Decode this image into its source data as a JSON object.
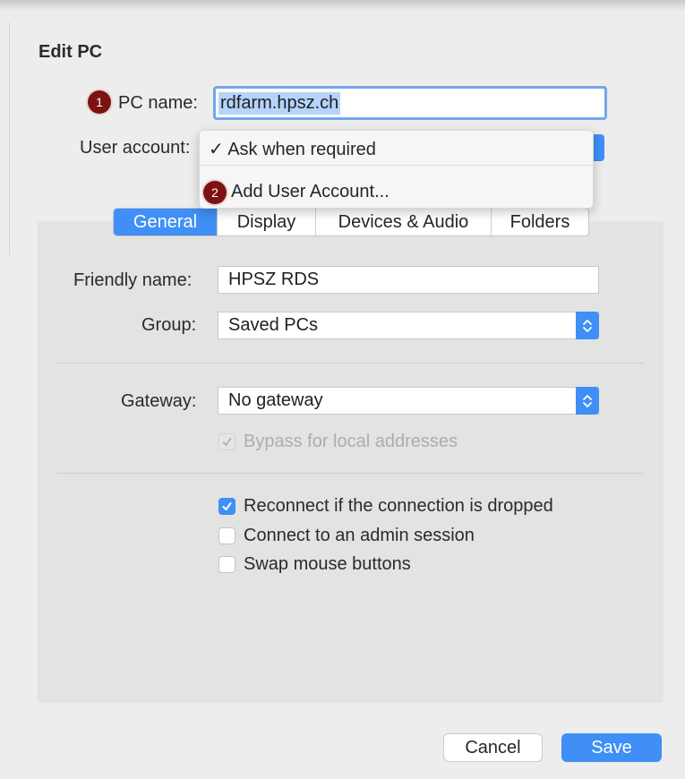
{
  "dialog": {
    "title": "Edit PC"
  },
  "pc_name": {
    "badge": "1",
    "label": "PC name:",
    "value": "rdfarm.hpsz.ch"
  },
  "user_account": {
    "label": "User account:",
    "menu": {
      "items": [
        {
          "check": "✓",
          "label": "Ask when required"
        },
        {
          "badge": "2",
          "label": "Add User Account..."
        }
      ]
    }
  },
  "tabs": [
    {
      "label": "General",
      "active": true
    },
    {
      "label": "Display",
      "active": false
    },
    {
      "label": "Devices & Audio",
      "active": false
    },
    {
      "label": "Folders",
      "active": false
    }
  ],
  "general": {
    "friendly_name": {
      "label": "Friendly name:",
      "value": "HPSZ RDS"
    },
    "group": {
      "label": "Group:",
      "value": "Saved PCs"
    },
    "gateway": {
      "label": "Gateway:",
      "value": "No gateway"
    },
    "bypass": {
      "label": "Bypass for local addresses",
      "checked": true,
      "disabled": true
    },
    "options": [
      {
        "label": "Reconnect if the connection is dropped",
        "checked": true
      },
      {
        "label": "Connect to an admin session",
        "checked": false
      },
      {
        "label": "Swap mouse buttons",
        "checked": false
      }
    ]
  },
  "buttons": {
    "cancel": "Cancel",
    "save": "Save"
  },
  "colors": {
    "accent": "#3f8ff7",
    "badge": "#7d1212",
    "panel": "#e3e3e3",
    "window": "#ededed"
  }
}
